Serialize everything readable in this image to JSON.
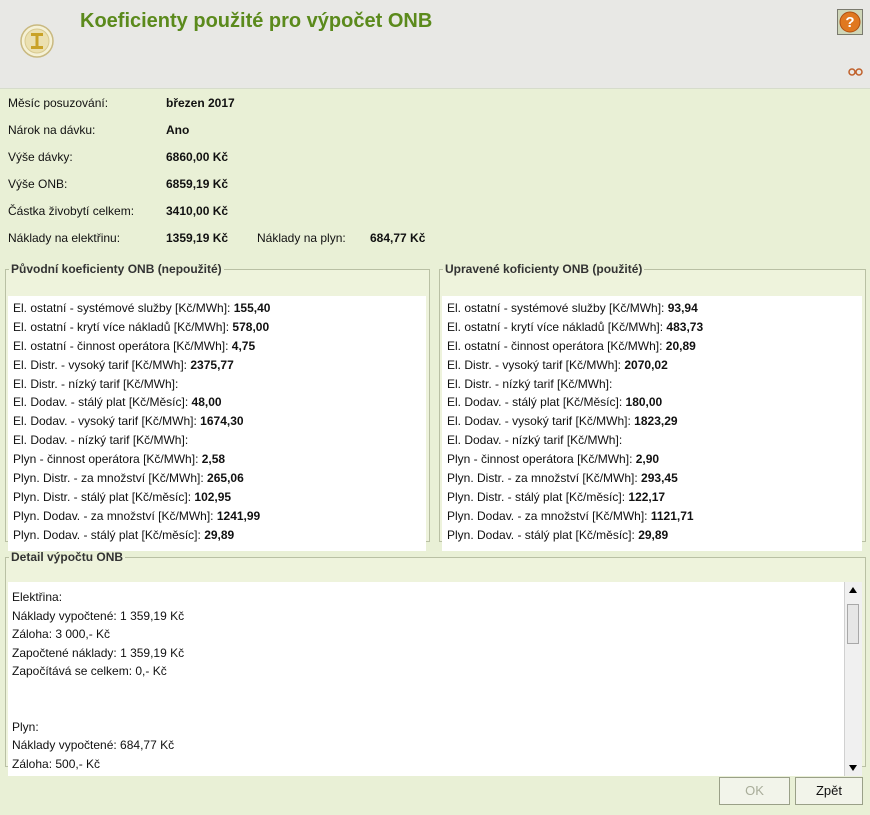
{
  "header": {
    "title": "Koeficienty použité pro výpočet ONB"
  },
  "info": [
    {
      "label": "Měsíc posuzování:",
      "value": "březen 2017"
    },
    {
      "label": "Nárok na dávku:",
      "value": "Ano"
    },
    {
      "label": "Výše dávky:",
      "value": "6860,00 Kč"
    },
    {
      "label": "Výše ONB:",
      "value": "6859,19 Kč"
    },
    {
      "label": "Částka živobytí celkem:",
      "value": "3410,00 Kč"
    },
    {
      "label": "Náklady na elektřinu:",
      "value": "1359,19 Kč",
      "extra_label": "Náklady na plyn:",
      "extra_value": "684,77 Kč"
    }
  ],
  "original": {
    "legend": "Původní koeficienty ONB (nepoužité)",
    "items": [
      {
        "label": "El. ostatní - systémové služby [Kč/MWh]:",
        "value": "155,40"
      },
      {
        "label": "El. ostatní - krytí více nákladů [Kč/MWh]:",
        "value": "578,00"
      },
      {
        "label": "El. ostatní - činnost operátora [Kč/MWh]:",
        "value": "4,75"
      },
      {
        "label": "El. Distr. - vysoký tarif [Kč/MWh]:",
        "value": "2375,77"
      },
      {
        "label": "El. Distr. - nízký tarif [Kč/MWh]:",
        "value": ""
      },
      {
        "label": "El. Dodav. - stálý plat [Kč/Měsíc]:",
        "value": "48,00"
      },
      {
        "label": "El. Dodav. - vysoký tarif [Kč/MWh]:",
        "value": "1674,30"
      },
      {
        "label": "El. Dodav. - nízký tarif [Kč/MWh]:",
        "value": ""
      },
      {
        "label": "Plyn - činnost operátora [Kč/MWh]:",
        "value": "2,58"
      },
      {
        "label": "Plyn. Distr. - za množství [Kč/MWh]:",
        "value": "265,06"
      },
      {
        "label": "Plyn. Distr. - stálý plat [Kč/měsíc]:",
        "value": "102,95"
      },
      {
        "label": "Plyn. Dodav. - za množství [Kč/MWh]:",
        "value": "1241,99"
      },
      {
        "label": "Plyn. Dodav. - stálý plat [Kč/měsíc]:",
        "value": "29,89"
      }
    ]
  },
  "adjusted": {
    "legend": "Upravené koficienty ONB (použité)",
    "items": [
      {
        "label": "El. ostatní - systémové služby [Kč/MWh]:",
        "value": "93,94"
      },
      {
        "label": "El. ostatní - krytí více nákladů [Kč/MWh]:",
        "value": "483,73"
      },
      {
        "label": "El. ostatní - činnost operátora [Kč/MWh]:",
        "value": "20,89"
      },
      {
        "label": "El. Distr. - vysoký tarif [Kč/MWh]:",
        "value": "2070,02"
      },
      {
        "label": "El. Distr. - nízký tarif [Kč/MWh]:",
        "value": ""
      },
      {
        "label": "El. Dodav. - stálý plat [Kč/Měsíc]:",
        "value": "180,00"
      },
      {
        "label": "El. Dodav. - vysoký tarif [Kč/MWh]:",
        "value": "1823,29"
      },
      {
        "label": "El. Dodav. - nízký tarif [Kč/MWh]:",
        "value": ""
      },
      {
        "label": "Plyn - činnost operátora [Kč/MWh]:",
        "value": "2,90"
      },
      {
        "label": "Plyn. Distr. - za množství [Kč/MWh]:",
        "value": "293,45"
      },
      {
        "label": "Plyn. Distr. - stálý plat [Kč/měsíc]:",
        "value": "122,17"
      },
      {
        "label": "Plyn. Dodav. - za množství [Kč/MWh]:",
        "value": "1121,71"
      },
      {
        "label": "Plyn. Dodav. - stálý plat [Kč/měsíc]:",
        "value": "29,89"
      }
    ]
  },
  "detail": {
    "legend": "Detail výpočtu ONB",
    "lines": [
      "Elektřina:",
      "Náklady vypočtené: 1 359,19 Kč",
      "Záloha: 3 000,- Kč",
      "Započtené náklady: 1 359,19 Kč",
      "Započítává se celkem: 0,- Kč",
      "",
      "",
      "Plyn:",
      "Náklady vypočtené: 684,77 Kč",
      "Záloha: 500,- Kč"
    ]
  },
  "buttons": {
    "ok": "OK",
    "back": "Zpět"
  },
  "colors": {
    "title": "#5b8a1c",
    "background": "#e9f0d6",
    "header": "#e8e8e5"
  }
}
